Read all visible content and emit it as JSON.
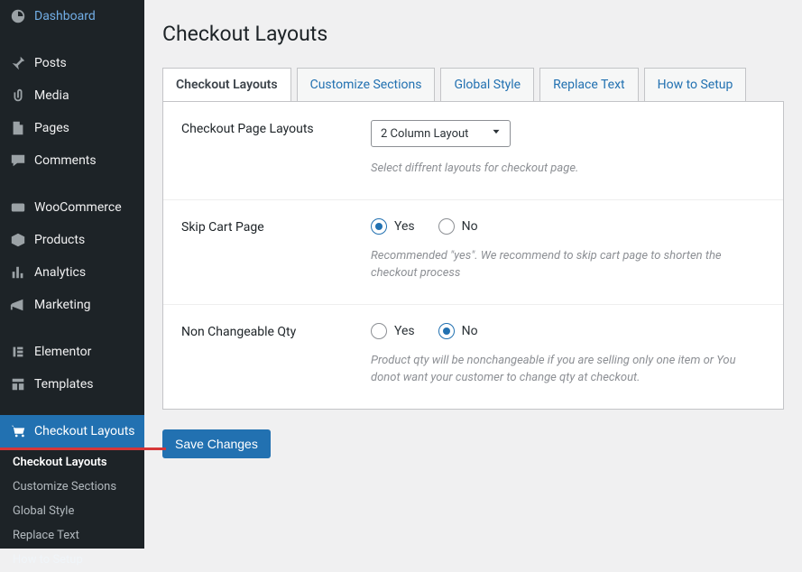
{
  "sidebar": {
    "items": [
      {
        "label": "Dashboard"
      },
      {
        "label": "Posts"
      },
      {
        "label": "Media"
      },
      {
        "label": "Pages"
      },
      {
        "label": "Comments"
      },
      {
        "label": "WooCommerce"
      },
      {
        "label": "Products"
      },
      {
        "label": "Analytics"
      },
      {
        "label": "Marketing"
      },
      {
        "label": "Elementor"
      },
      {
        "label": "Templates"
      },
      {
        "label": "Checkout Layouts"
      }
    ],
    "subitems": [
      {
        "label": "Checkout Layouts"
      },
      {
        "label": "Customize Sections"
      },
      {
        "label": "Global Style"
      },
      {
        "label": "Replace Text"
      },
      {
        "label": "How to Setup"
      }
    ]
  },
  "page": {
    "title": "Checkout Layouts"
  },
  "tabs": [
    {
      "label": "Checkout Layouts"
    },
    {
      "label": "Customize Sections"
    },
    {
      "label": "Global Style"
    },
    {
      "label": "Replace Text"
    },
    {
      "label": "How to Setup"
    }
  ],
  "settings": {
    "layout": {
      "label": "Checkout Page Layouts",
      "value": "2 Column Layout",
      "desc": "Select diffrent layouts for checkout page."
    },
    "skip_cart": {
      "label": "Skip Cart Page",
      "options": {
        "yes": "Yes",
        "no": "No"
      },
      "value": "yes",
      "desc": "Recommended \"yes\". We recommend to skip cart page to shorten the checkout process"
    },
    "non_changeable_qty": {
      "label": "Non Changeable Qty",
      "options": {
        "yes": "Yes",
        "no": "No"
      },
      "value": "no",
      "desc": "Product qty will be nonchangeable if you are selling only one item or You donot want your customer to change qty at checkout."
    }
  },
  "actions": {
    "save": "Save Changes"
  }
}
